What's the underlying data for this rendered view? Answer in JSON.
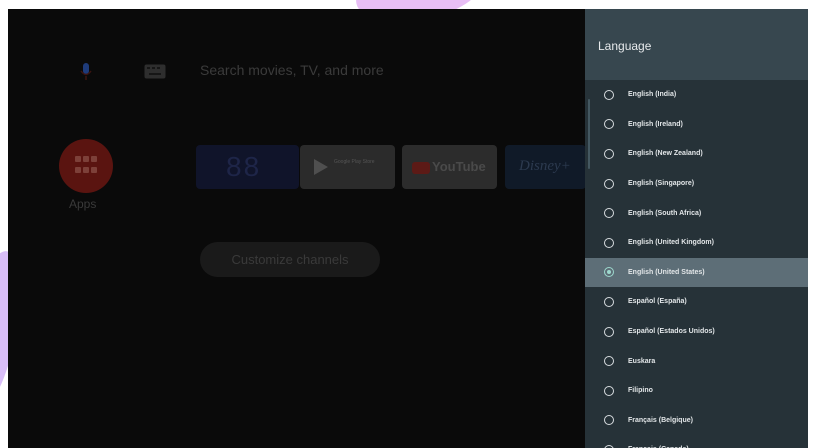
{
  "home": {
    "search_placeholder": "Search movies, TV, and more",
    "apps_label": "Apps",
    "cards": {
      "card_88": "88",
      "play_store": "Google Play Store",
      "youtube": "YouTube",
      "disney": "Disney+"
    },
    "customize_label": "Customize channels"
  },
  "language_panel": {
    "title": "Language",
    "items": [
      {
        "label": "English (India)",
        "selected": false
      },
      {
        "label": "English (Ireland)",
        "selected": false
      },
      {
        "label": "English (New Zealand)",
        "selected": false
      },
      {
        "label": "English (Singapore)",
        "selected": false
      },
      {
        "label": "English (South Africa)",
        "selected": false
      },
      {
        "label": "English (United Kingdom)",
        "selected": false
      },
      {
        "label": "English (United States)",
        "selected": true
      },
      {
        "label": "Español (España)",
        "selected": false
      },
      {
        "label": "Español (Estados Unidos)",
        "selected": false
      },
      {
        "label": "Euskara",
        "selected": false
      },
      {
        "label": "Filipino",
        "selected": false
      },
      {
        "label": "Français (Belgique)",
        "selected": false
      },
      {
        "label": "Français (Canada)",
        "selected": false
      }
    ]
  },
  "colors": {
    "panel_bg": "#263238",
    "panel_header_bg": "#37474f",
    "selected_row_bg": "#5d6e77",
    "accent_radio": "#9dd8cd"
  }
}
